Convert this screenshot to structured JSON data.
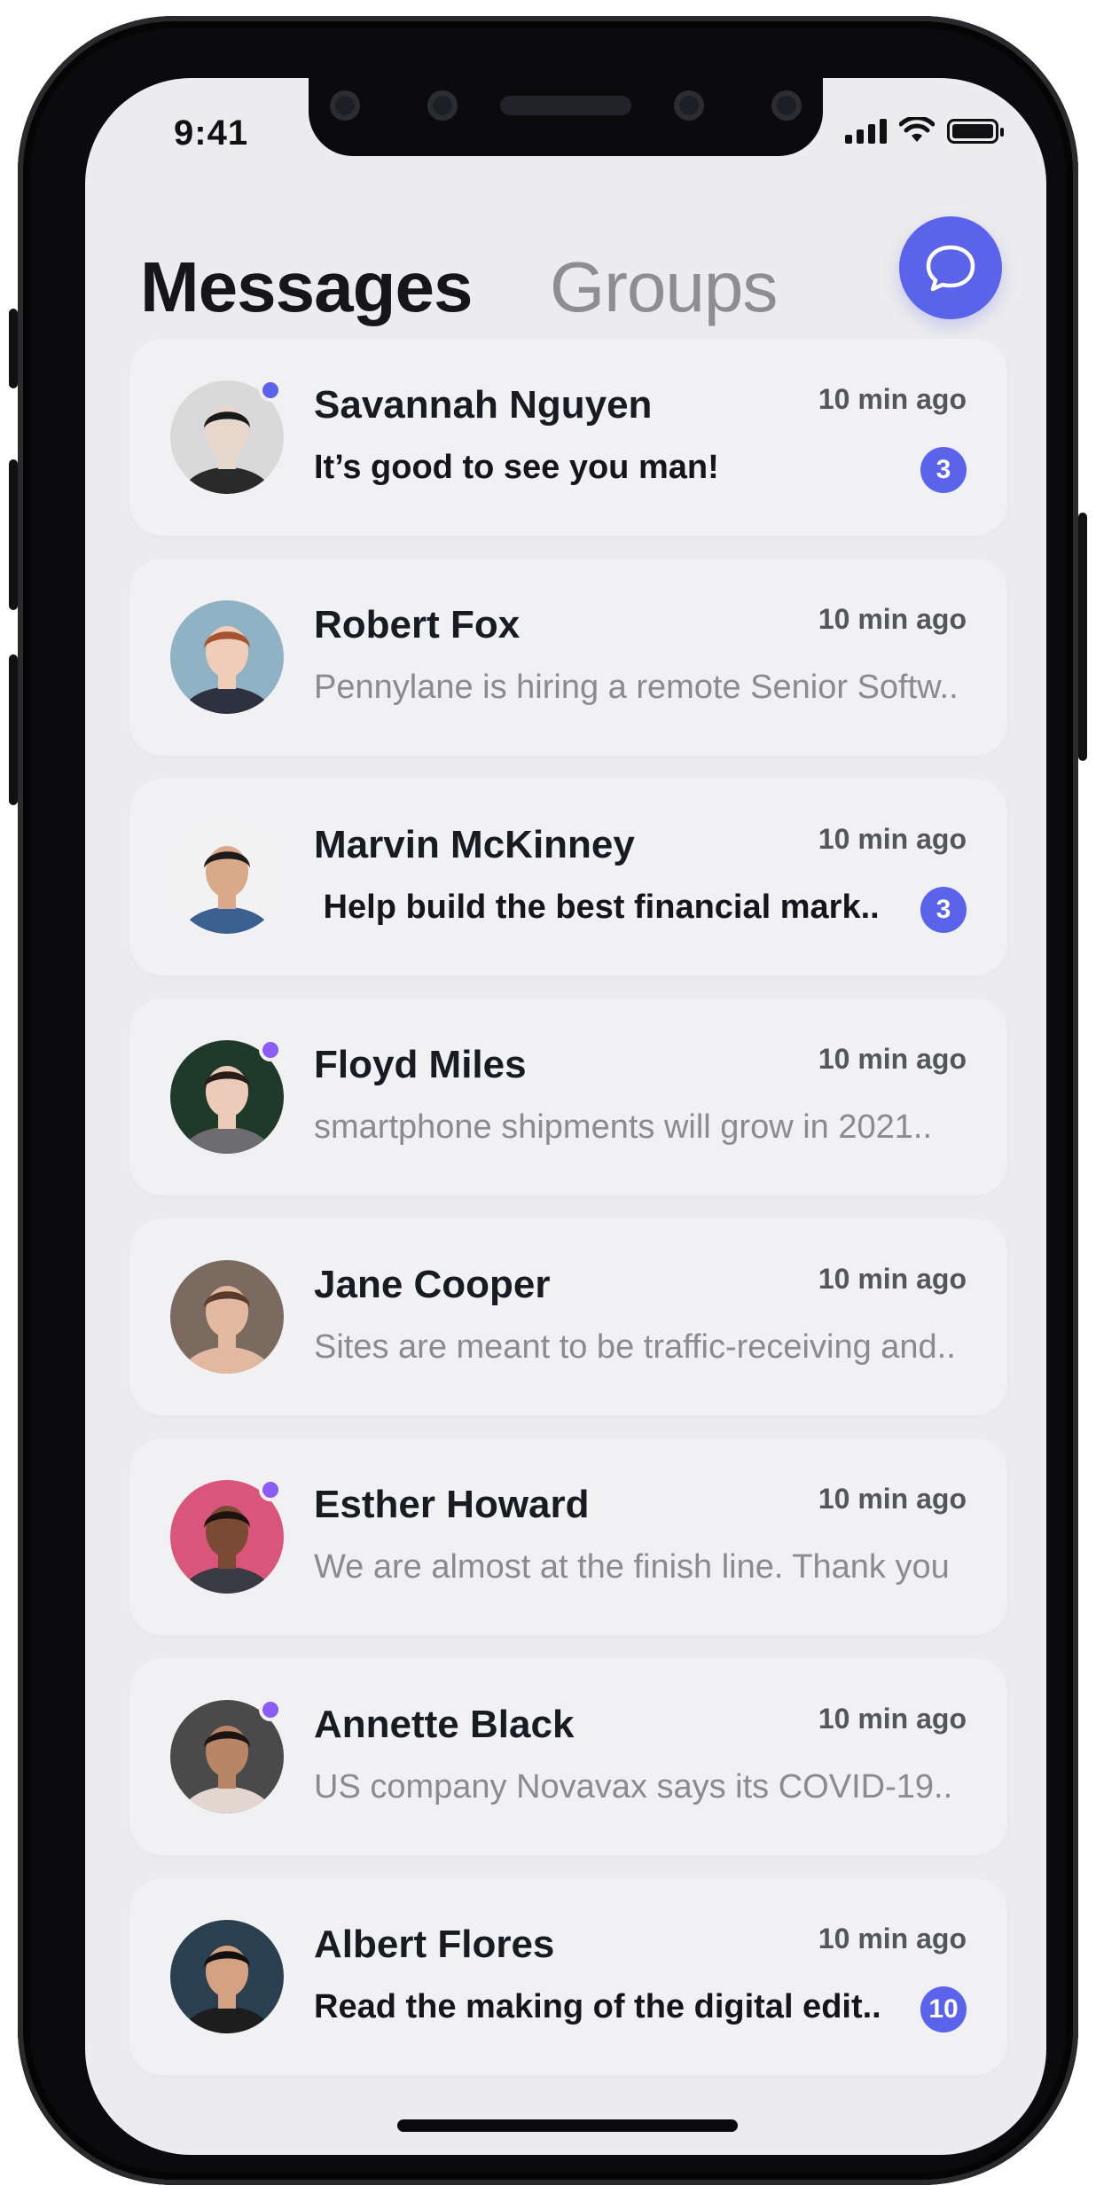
{
  "status_bar": {
    "time": "9:41"
  },
  "header": {
    "active_tab": "Messages",
    "inactive_tab": "Groups"
  },
  "colors": {
    "accent": "#5a63ea",
    "online_blue": "#5a63ea",
    "online_purple": "#8b5cf6"
  },
  "conversations": [
    {
      "name": "Savannah Nguyen",
      "time": "10 min ago",
      "preview": "It’s good to see you man!",
      "unread": true,
      "badge": "3",
      "online": "#5a63ea",
      "skin": "#e8d7cc",
      "hair": "#1a1a1a",
      "bg": "#d9d9d9",
      "shirt": "#2a2a2a"
    },
    {
      "name": "Robert Fox",
      "time": "10 min ago",
      "preview": "Pennylane is hiring a remote Senior Softw..",
      "unread": false,
      "badge": "",
      "online": "",
      "skin": "#efcdb8",
      "hair": "#a8532f",
      "bg": "#8fb3c4",
      "shirt": "#2e3140"
    },
    {
      "name": "Marvin McKinney",
      "time": "10 min ago",
      "preview": " Help build the best financial mark..",
      "unread": true,
      "badge": "3",
      "online": "",
      "skin": "#d9a98a",
      "hair": "#1c1c1c",
      "bg": "#f2f2f2",
      "shirt": "#3b5f8f"
    },
    {
      "name": "Floyd Miles",
      "time": "10 min ago",
      "preview": "smartphone shipments will grow in 2021..",
      "unread": false,
      "badge": "",
      "online": "#8b5cf6",
      "skin": "#eccbbb",
      "hair": "#2a1c16",
      "bg": "#1f3a2a",
      "shirt": "#6d6d70"
    },
    {
      "name": "Jane Cooper",
      "time": "10 min ago",
      "preview": "Sites are meant to be traffic-receiving and..",
      "unread": false,
      "badge": "",
      "online": "",
      "skin": "#e3b8a0",
      "hair": "#5a3a2a",
      "bg": "#7a6a60",
      "shirt": "#e3b8a0"
    },
    {
      "name": "Esther Howard",
      "time": "10 min ago",
      "preview": "We are almost at the finish line. Thank you",
      "unread": false,
      "badge": "",
      "online": "#8b5cf6",
      "skin": "#7a4a34",
      "hair": "#1c120e",
      "bg": "#d9557a",
      "shirt": "#3a3a44"
    },
    {
      "name": "Annette Black",
      "time": "10 min ago",
      "preview": "US company Novavax says its COVID-19..",
      "unread": false,
      "badge": "",
      "online": "#8b5cf6",
      "skin": "#b98567",
      "hair": "#1b1412",
      "bg": "#4a4a4a",
      "shirt": "#e2d6ce"
    },
    {
      "name": "Albert Flores",
      "time": "10 min ago",
      "preview": "Read the making of the digital edit..",
      "unread": true,
      "badge": "10",
      "online": "",
      "skin": "#d4a283",
      "hair": "#111111",
      "bg": "#2a3f4f",
      "shirt": "#1d1d1d"
    }
  ]
}
